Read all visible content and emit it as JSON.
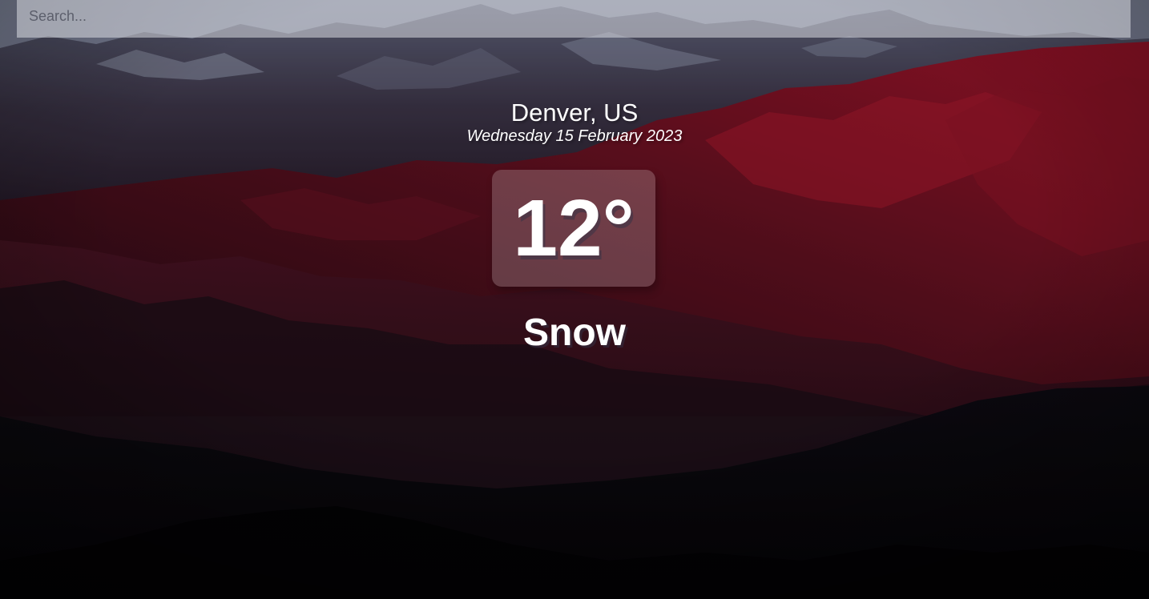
{
  "search": {
    "placeholder": "Search...",
    "value": ""
  },
  "location": {
    "city": "Denver, US",
    "date": "Wednesday 15 February 2023"
  },
  "weather": {
    "temperature": "12°",
    "condition": "Snow"
  },
  "colors": {
    "text": "#ffffff",
    "background_dark": "#07070b",
    "mountain_red": "#8e1326",
    "sky": "#7b7f96",
    "search_bg": "#e1e2e8"
  },
  "background": {
    "icon": "mountain-landscape-image"
  }
}
